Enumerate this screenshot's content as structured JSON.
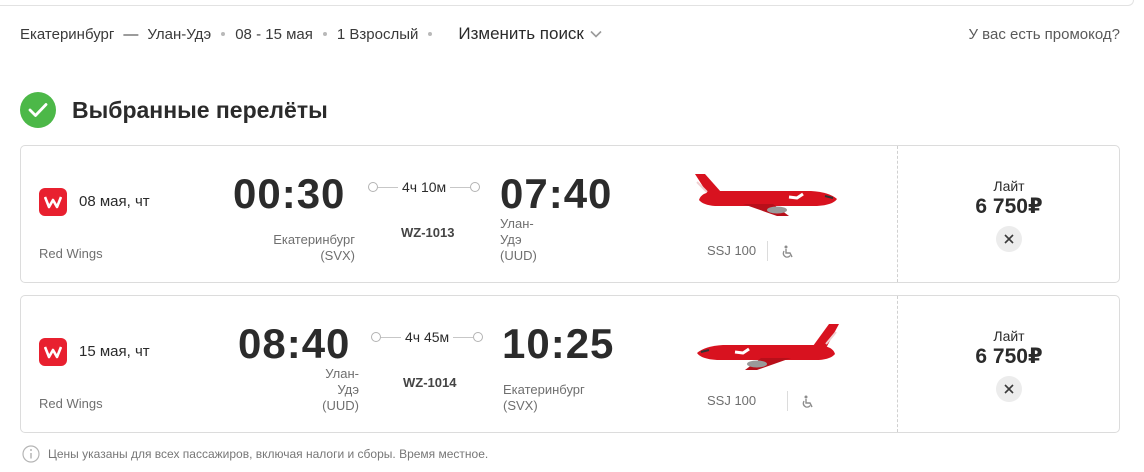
{
  "search": {
    "route_from": "Екатеринбург",
    "route_dash": "—",
    "route_to": "Улан-Удэ",
    "dates": "08 - 15 мая",
    "passengers": "1 Взрослый",
    "change_label": "Изменить поиск",
    "promo_label": "У вас есть промокод?"
  },
  "section": {
    "title": "Выбранные перелёты"
  },
  "flights": [
    {
      "date": "08 мая, чт",
      "airline": "Red Wings",
      "dep_time": "00:30",
      "dep_city": "Екатеринбург",
      "dep_code": "(SVX)",
      "duration": "4ч 10м",
      "flight_number": "WZ-1013",
      "arr_time": "07:40",
      "arr_city_1": "Улан-",
      "arr_city_2": "Удэ",
      "arr_code": "(UUD)",
      "aircraft": "SSJ 100",
      "fare": "Лайт",
      "price": "6 750₽"
    },
    {
      "date": "15 мая, чт",
      "airline": "Red Wings",
      "dep_time": "08:40",
      "dep_city_1": "Улан-",
      "dep_city_2": "Удэ",
      "dep_code": "(UUD)",
      "duration": "4ч 45м",
      "flight_number": "WZ-1014",
      "arr_time": "10:25",
      "arr_city": "Екатеринбург",
      "arr_code": "(SVX)",
      "aircraft": "SSJ 100",
      "fare": "Лайт",
      "price": "6 750₽"
    }
  ],
  "footer_note": "Цены указаны для всех пассажиров, включая налоги и сборы. Время местное.",
  "colors": {
    "brand_red": "#e8202f",
    "check_green": "#4cb848"
  },
  "icons": [
    "check-icon",
    "chevron-down-icon",
    "airline-logo-icon",
    "airplane-image",
    "wheelchair-icon",
    "close-icon",
    "info-icon"
  ]
}
